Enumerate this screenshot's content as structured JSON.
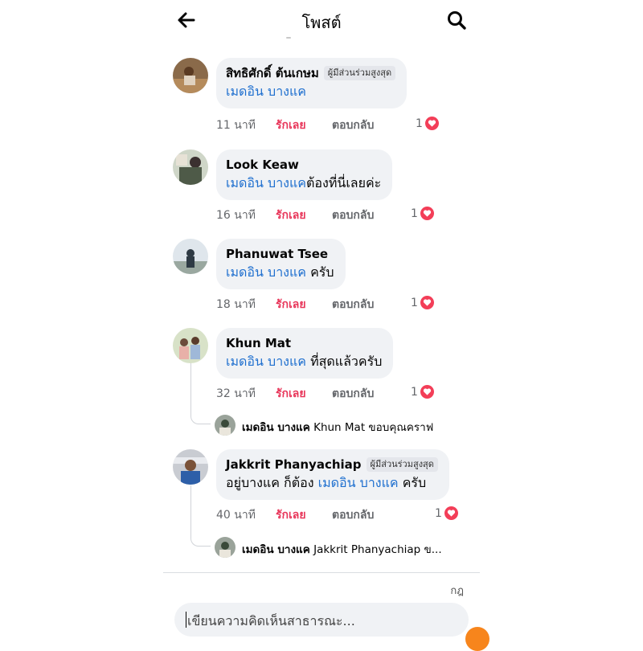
{
  "header": {
    "title": "โพสต์",
    "back_icon": "arrow-left-icon",
    "search_icon": "search-icon"
  },
  "comments": [
    {
      "name": "สิทธิศักดิ์ ต้นเกษม",
      "badge": "ผู้มีส่วนร่วมสูงสุด",
      "text_before": "",
      "mention": "เมดอิน บางแค",
      "text_after": "",
      "time": "11 นาที",
      "like": "รักเลย",
      "reply": "ตอบกลับ",
      "reactions": "1"
    },
    {
      "name": "Look Keaw",
      "badge": "",
      "text_before": "",
      "mention": "เมดอิน บางแค",
      "text_after": "ต้องที่นี่เลยค่ะ",
      "time": "16 นาที",
      "like": "รักเลย",
      "reply": "ตอบกลับ",
      "reactions": "1"
    },
    {
      "name": "Phanuwat Tsee",
      "badge": "",
      "text_before": "",
      "mention": "เมดอิน บางแค",
      "text_after": " ครับ",
      "time": "18 นาที",
      "like": "รักเลย",
      "reply": "ตอบกลับ",
      "reactions": "1"
    },
    {
      "name": "Khun Mat",
      "badge": "",
      "text_before": "",
      "mention": "เมดอิน บางแค",
      "text_after": " ที่สุดแล้วครับ",
      "time": "32 นาที",
      "like": "รักเลย",
      "reply": "ตอบกลับ",
      "reactions": "1",
      "reply_preview": {
        "author": "เมดอิน บางแค",
        "text": "Khun Mat ขอบคุณคราฟ"
      }
    },
    {
      "name": "Jakkrit Phanyachiap",
      "badge": "ผู้มีส่วนร่วมสูงสุด",
      "text_before": "อยู่บางแค ก็ต้อง ",
      "mention": "เมดอิน บางแค",
      "text_after": " ครับ",
      "time": "40 นาที",
      "like": "รักเลย",
      "reply": "ตอบกลับ",
      "reactions": "1",
      "reply_preview": {
        "author": "เมดอิน บางแค",
        "text": "Jakkrit Phanyachiap ข..."
      }
    }
  ],
  "footer": {
    "tag": "กฎ",
    "composer_placeholder": "เขียนความคิดเห็นสาธารณะ..."
  },
  "colors": {
    "mention": "#1e6fcf",
    "like": "#e8365a",
    "heart": "#f33e58",
    "bubble": "#f0f2f5"
  }
}
